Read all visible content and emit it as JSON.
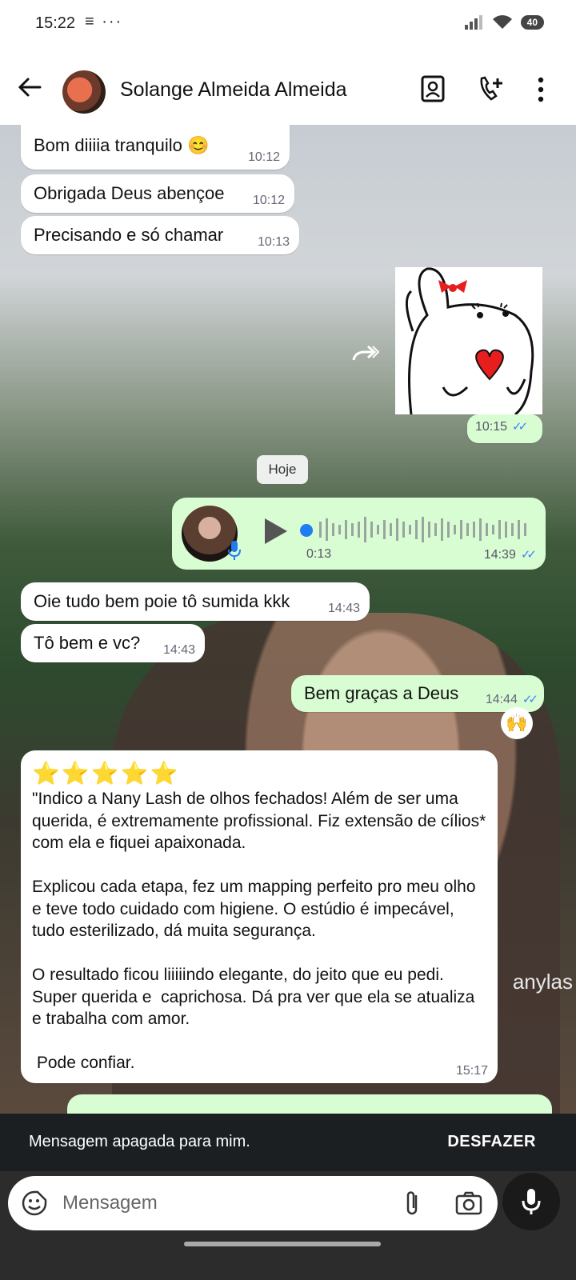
{
  "status_bar": {
    "time": "15:22",
    "notif_icons": "≡ ···",
    "battery": "40"
  },
  "header": {
    "contact_name": "Solange Almeida Almeida"
  },
  "messages": [
    {
      "dir": "in",
      "text": "Bom diiiia tranquilo 😊",
      "time": "10:12"
    },
    {
      "dir": "in",
      "text": "Obrigada Deus abençoe",
      "time": "10:12"
    },
    {
      "dir": "in",
      "text": "Precisando e só chamar",
      "time": "10:13"
    },
    {
      "dir": "out",
      "type": "sticker",
      "time": "10:15"
    },
    {
      "dir": "out",
      "type": "voice",
      "duration": "0:13",
      "time": "14:39"
    },
    {
      "dir": "in",
      "text": "Oie tudo bem poie tô sumida kkk",
      "time": "14:43"
    },
    {
      "dir": "in",
      "text": "Tô bem e vc?",
      "time": "14:43"
    },
    {
      "dir": "out",
      "text": "Bem graças a Deus",
      "time": "14:44",
      "reaction": "🙌"
    },
    {
      "dir": "in",
      "stars": "⭐⭐⭐⭐⭐",
      "text": "\"Indico a Nany Lash de olhos fechados! Além de ser uma querida, é extremamente profissional. Fiz extensão de cílios* com ela e fiquei apaixonada.\n\nExplicou cada etapa, fez um mapping perfeito pro meu olho e teve todo cuidado com higiene. O estúdio é impecável, tudo esterilizado, dá muita segurança.\n\nO resultado ficou liiiiindo elegante, do jeito que eu pedi. Super querida e  caprichosa. Dá pra ver que ela se atualiza e trabalha com amor.\n\n Pode confiar.",
      "time": "15:17"
    }
  ],
  "date_separator": "Hoje",
  "background_watermark": "anylas",
  "snackbar": {
    "message": "Mensagem apagada para mim.",
    "action": "DESFAZER"
  },
  "composer": {
    "placeholder": "Mensagem"
  },
  "colors": {
    "outgoing_bubble": "#d9fdd3",
    "incoming_bubble": "#ffffff",
    "read_ticks": "#3b82f6"
  }
}
